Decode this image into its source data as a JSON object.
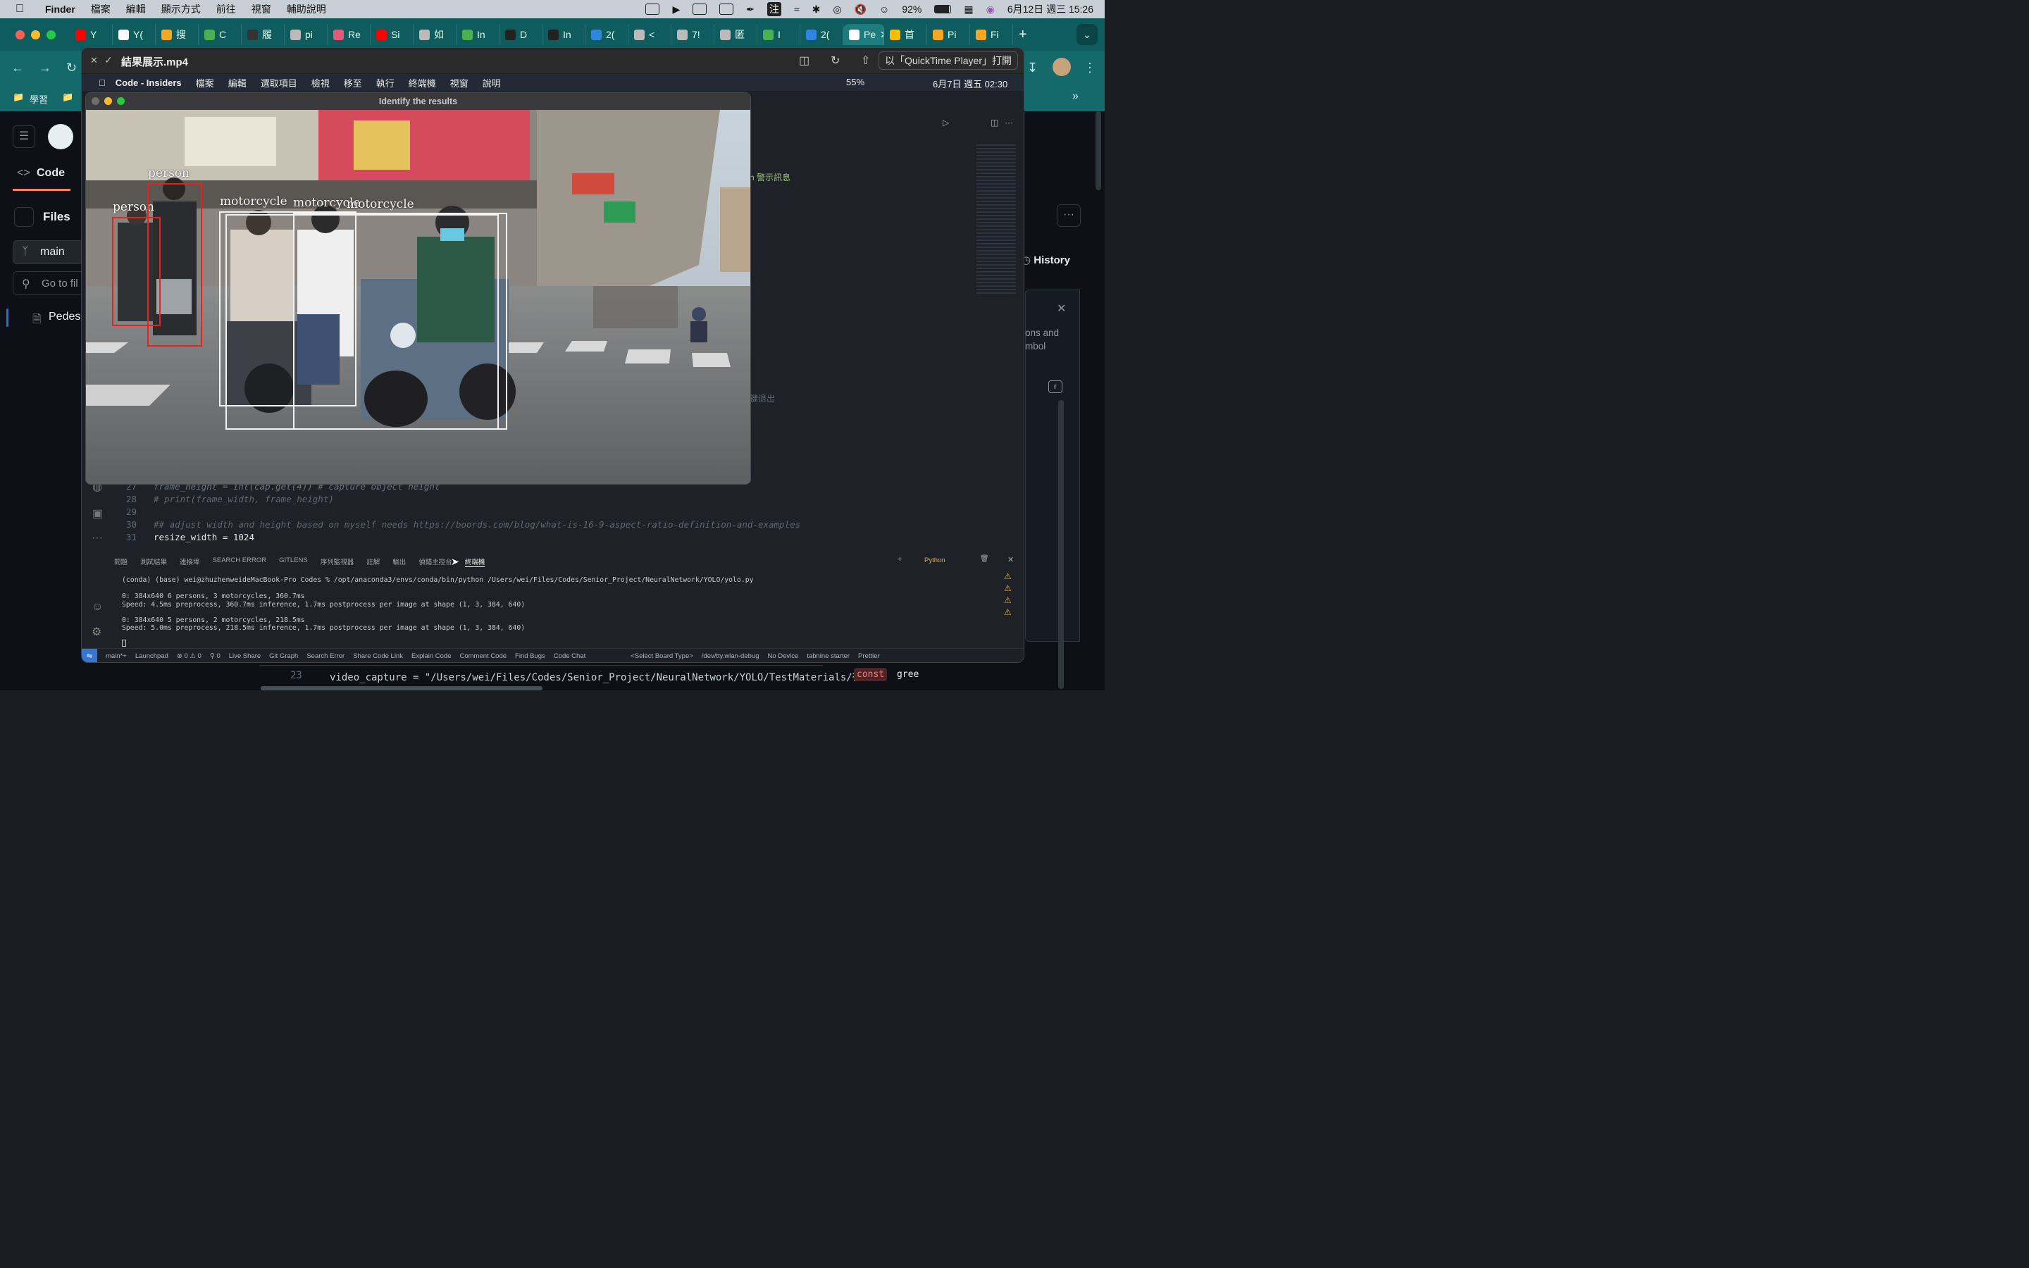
{
  "menubar": {
    "app": "Finder",
    "items": [
      "檔案",
      "編輯",
      "顯示方式",
      "前往",
      "視窗",
      "輔助說明"
    ],
    "battery": "92%",
    "datetime": "6月12日 週三 15:26"
  },
  "chrome": {
    "tabs": [
      {
        "label": "Y",
        "color": "#ff0000"
      },
      {
        "label": "Y(",
        "color": "#ffffff"
      },
      {
        "label": "搜",
        "color": "#f5a623"
      },
      {
        "label": "C",
        "color": "#4caf50"
      },
      {
        "label": "履",
        "color": "#333333"
      },
      {
        "label": "pi",
        "color": "#bbbbbb"
      },
      {
        "label": "Re",
        "color": "#e05a7c"
      },
      {
        "label": "Si",
        "color": "#ff0000"
      },
      {
        "label": "如",
        "color": "#bbbbbb"
      },
      {
        "label": "In",
        "color": "#4caf50"
      },
      {
        "label": "D",
        "color": "#222222"
      },
      {
        "label": "In",
        "color": "#222222"
      },
      {
        "label": "2(",
        "color": "#2e86de"
      },
      {
        "label": "<",
        "color": "#bbbbbb"
      },
      {
        "label": "7!",
        "color": "#bbbbbb"
      },
      {
        "label": "匿",
        "color": "#bbbbbb"
      },
      {
        "label": "I",
        "color": "#4caf50"
      },
      {
        "label": "2(",
        "color": "#2e86de"
      },
      {
        "label": "Pe",
        "color": "#ffffff"
      },
      {
        "label": "首",
        "color": "#fbbc04"
      },
      {
        "label": "Pi",
        "color": "#f5a623"
      },
      {
        "label": "Fi",
        "color": "#f5a623"
      }
    ],
    "bookmarks": [
      "學習"
    ]
  },
  "github": {
    "code_tab": "Code",
    "files_heading": "Files",
    "branch": "main",
    "goto_placeholder": "Go to fil",
    "file_item": "Pedes",
    "history": "History",
    "side_text_1": "ons and",
    "side_text_2": "mbol",
    "hint_key": "r",
    "bottom_line_num": "23",
    "bottom_line_code": "video_capture = \"/Users/wei/Files/Codes/Senior_Project/NeuralNetwork/YOLO/TestMaterials/行",
    "bottom_const": "const",
    "bottom_gree": "gree"
  },
  "quicktime": {
    "title": "結果展示.mp4",
    "open_with": "以「QuickTime Player」打開"
  },
  "inner_menubar": {
    "app": "Code - Insiders",
    "items": [
      "檔案",
      "編輯",
      "選取項目",
      "檢視",
      "移至",
      "執行",
      "終端機",
      "視窗",
      "說明"
    ],
    "battery": "55%",
    "datetime": "6月7日 週五 02:30"
  },
  "vscode": {
    "partial_text_1": "h 警示訊息",
    "partial_text_2": "鍵退出",
    "code_lines": [
      {
        "num": "27",
        "code": "frame_height = int(cap.get(4)) # capture object height"
      },
      {
        "num": "28",
        "code": "# print(frame_width, frame_height)"
      },
      {
        "num": "29",
        "code": ""
      },
      {
        "num": "30",
        "code": "## adjust width and height based on myself needs https://boords.com/blog/what-is-16-9-aspect-ratio-definition-and-examples"
      },
      {
        "num": "31",
        "code": "resize_width = 1024"
      }
    ],
    "panel_tabs": [
      "問題",
      "測試結果",
      "連接埠",
      "SEARCH ERROR",
      "GITLENS",
      "序列監視器",
      "註解",
      "輸出",
      "偵錯主控台",
      "終端機"
    ],
    "panel_active_tab": "終端機",
    "panel_shell": "Python",
    "terminal": [
      "(conda) (base) wei@zhuzhenweideMacBook-Pro Codes % /opt/anaconda3/envs/conda/bin/python /Users/wei/Files/Codes/Senior_Project/NeuralNetwork/YOLO/yolo.py",
      "0: 384x640 6 persons, 3 motorcycles, 360.7ms",
      "Speed: 4.5ms preprocess, 360.7ms inference, 1.7ms postprocess per image at shape (1, 3, 384, 640)",
      "0: 384x640 5 persons, 2 motorcycles, 218.5ms",
      "Speed: 5.0ms preprocess, 218.5ms inference, 1.7ms postprocess per image at shape (1, 3, 384, 640)"
    ],
    "statusbar": [
      "main*+",
      "Launchpad",
      "⊗ 0 ⚠ 0",
      "⚲ 0",
      "Live Share",
      "Git Graph",
      "Search Error",
      "Share Code Link",
      "Explain Code",
      "Comment Code",
      "Find Bugs",
      "Code Chat",
      "<Select Board Type>",
      "/dev/tty.wlan-debug",
      "No Device",
      "tabnine starter",
      "Prettier"
    ]
  },
  "detection_window": {
    "title": "Identify the results",
    "labels": {
      "person_a": "person",
      "person_b": "person",
      "moto_a": "motorcycle",
      "moto_b": "motorcycle",
      "moto_c": "motorcycle"
    },
    "colors": {
      "person": "#e8221c",
      "motorcycle": "#f2f2f2"
    }
  }
}
